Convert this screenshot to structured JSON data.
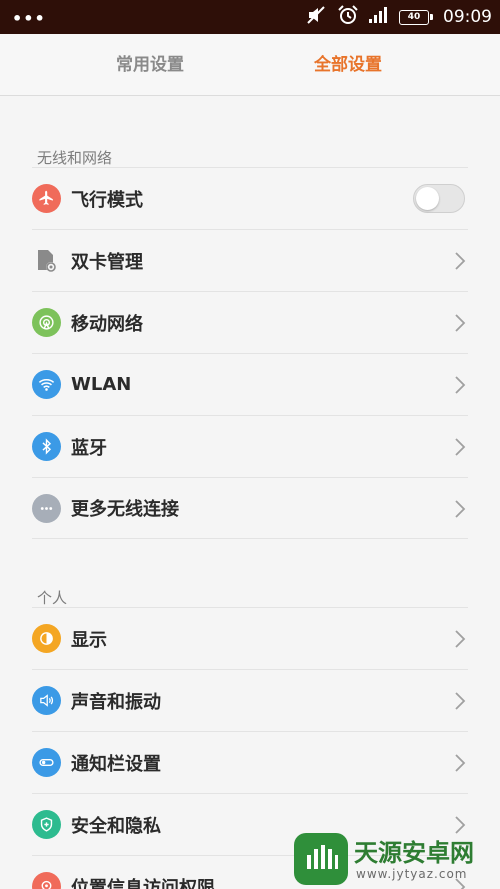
{
  "status_bar": {
    "time": "09:09",
    "battery": "40",
    "icons": [
      "more-dots-icon",
      "mute-icon",
      "alarm-icon",
      "signal-icon",
      "battery-icon"
    ]
  },
  "tabs": [
    {
      "label": "常用设置",
      "active": false
    },
    {
      "label": "全部设置",
      "active": true
    }
  ],
  "colors": {
    "accent": "#e8742b",
    "status_bar": "#2e0f08"
  },
  "sections": [
    {
      "title": "无线和网络",
      "items": [
        {
          "label": "飞行模式",
          "icon": "airplane-icon",
          "color": "#f06b5a",
          "control": "toggle",
          "toggle_on": false
        },
        {
          "label": "双卡管理",
          "icon": "sim-card-icon",
          "color": "#8a8a8a",
          "control": "chevron"
        },
        {
          "label": "移动网络",
          "icon": "mobile-network-icon",
          "color": "#7dc25b",
          "control": "chevron"
        },
        {
          "label": "WLAN",
          "icon": "wifi-icon",
          "color": "#3b9ae6",
          "control": "chevron"
        },
        {
          "label": "蓝牙",
          "icon": "bluetooth-icon",
          "color": "#3b9ae6",
          "control": "chevron"
        },
        {
          "label": "更多无线连接",
          "icon": "more-icon",
          "color": "#a7aeb8",
          "control": "chevron"
        }
      ]
    },
    {
      "title": "个人",
      "items": [
        {
          "label": "显示",
          "icon": "display-icon",
          "color": "#f4a623",
          "control": "chevron"
        },
        {
          "label": "声音和振动",
          "icon": "speaker-icon",
          "color": "#3b9ae6",
          "control": "chevron"
        },
        {
          "label": "通知栏设置",
          "icon": "notification-icon",
          "color": "#3b9ae6",
          "control": "chevron"
        },
        {
          "label": "安全和隐私",
          "icon": "shield-icon",
          "color": "#2dbb8f",
          "control": "chevron"
        },
        {
          "label": "位置信息访问权限",
          "icon": "location-icon",
          "color": "#f06b5a",
          "control": "chevron"
        }
      ]
    }
  ],
  "watermark": {
    "title": "天源安卓网",
    "url": "www.jytyaz.com"
  }
}
